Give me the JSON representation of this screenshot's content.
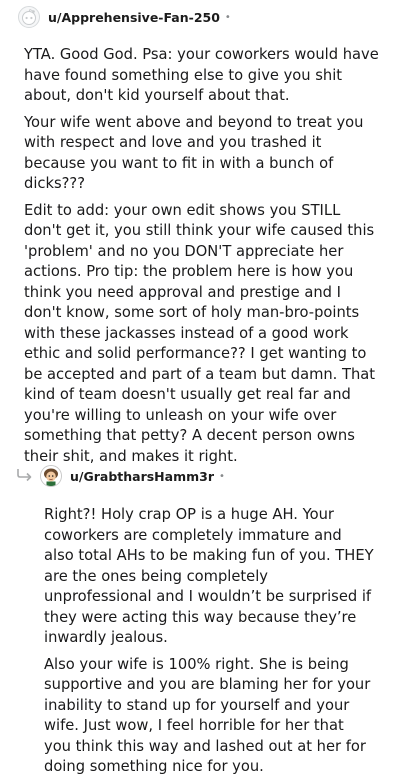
{
  "comment": {
    "username": "u/Apprehensive-Fan-250",
    "separator": "•",
    "avatar_icon": "reddit-snoo-avatar-icon",
    "paragraphs": [
      "YTA. Good God. Psa: your coworkers would have have found something else to give you shit about, don't kid yourself about that.",
      "Your wife went above and beyond to treat you with respect and love and you trashed it because you want to fit in with a bunch of dicks???",
      "Edit to add: your own edit shows you STILL don't get it, you still think your wife caused this 'problem' and no you DON'T appreciate her actions. Pro tip: the problem here is how you think you need approval and prestige and I don't know, some sort of holy man-bro-points with these jackasses instead of a good work ethic and solid performance?? I get wanting to be accepted and part of a team but damn. That kind of team doesn't usually get real far and you're willing to unleash on your wife over something that petty? A decent person owns their shit, and makes it right."
    ]
  },
  "reply": {
    "username": "u/GrabtharsHamm3r",
    "separator": "•",
    "avatar_icon": "cartoon-avatar-icon",
    "reply_icon": "reply-arrow-icon",
    "paragraphs": [
      "Right?! Holy crap OP is a huge AH. Your coworkers are completely immature and also total AHs to be making fun of you. THEY are the ones being completely unprofessional and I wouldn’t be surprised if they were acting this way because they’re inwardly jealous.",
      "Also your wife is 100% right. She is being supportive and you are blaming her for your inability to stand up for yourself and your wife. Just wow, I feel horrible for her that you think this way and lashed out at her for doing something nice for you."
    ]
  }
}
